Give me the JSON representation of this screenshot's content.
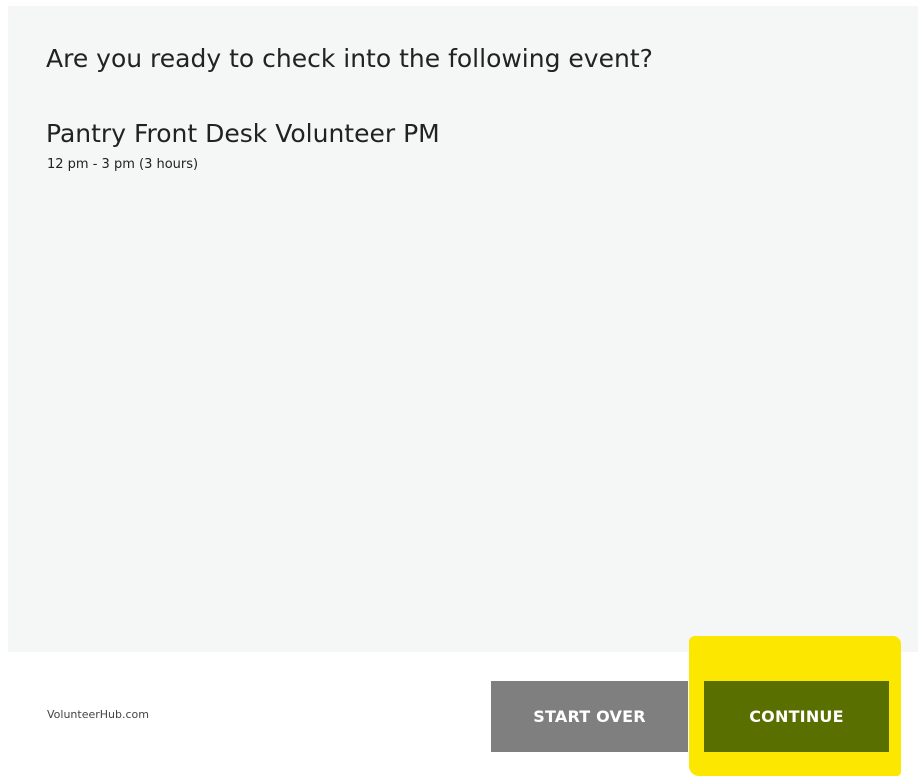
{
  "checkin": {
    "question": "Are you ready to check into the following event?",
    "event_title": "Pantry Front Desk Volunteer PM",
    "event_time": "12 pm - 3 pm (3 hours)"
  },
  "footer": {
    "brand": "VolunteerHub.com",
    "start_over_label": "START OVER",
    "continue_label": "CONTINUE"
  },
  "colors": {
    "panel_background": "#f5f6f6",
    "start_over_button": "#7f7f7f",
    "continue_button": "#597000",
    "highlight": "#fbe700"
  }
}
